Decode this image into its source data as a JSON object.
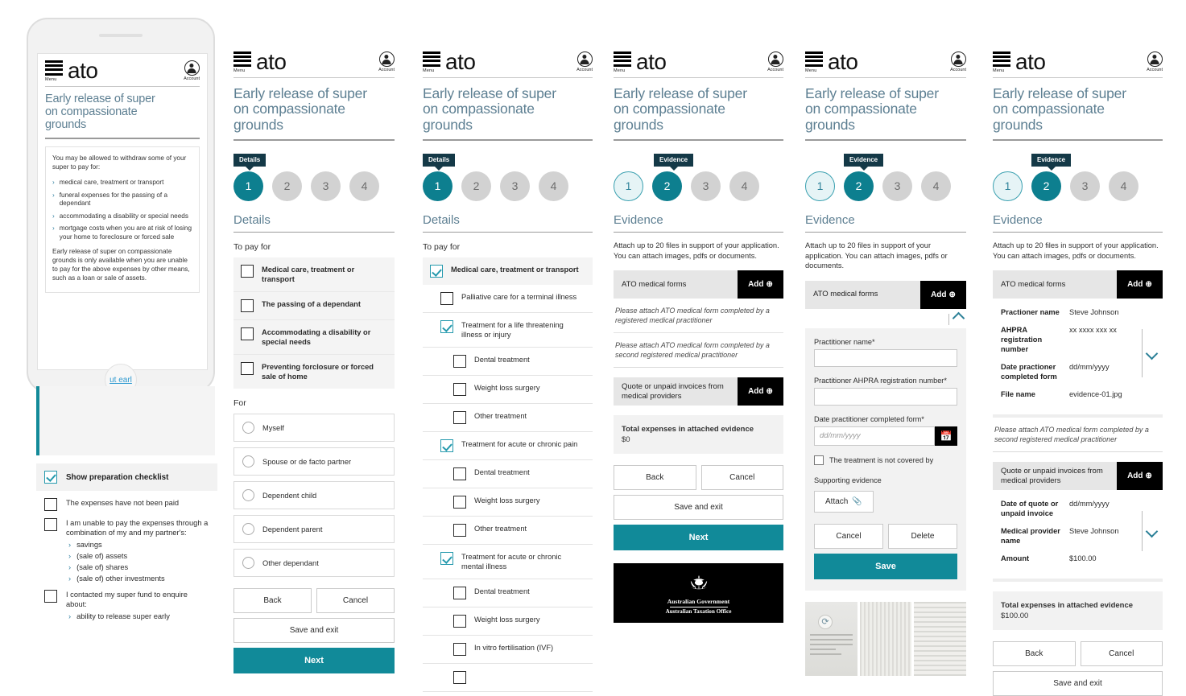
{
  "brand": {
    "logo_text": "ato",
    "menu_label": "Menu",
    "account_label": "Account"
  },
  "page_title": "Early release of super\non compassionate\ngrounds",
  "screen1": {
    "intro": "You may be allowed to withdraw some of your super to pay for:",
    "bullets": [
      "medical care, treatment or transport",
      "funeral expenses for the passing of a dependant",
      "accommodating a disability or special needs",
      "mortgage costs when you are at risk of losing your home to foreclosure or forced sale"
    ],
    "paragraph": "Early release of super on compassionate grounds is only available when you are unable to pay for the above expenses by other means, such as a loan or sale of assets.",
    "home_link": "ut earl",
    "checklist_header": "Show preparation checklist",
    "checklist": [
      {
        "label": "The expenses have not been paid",
        "subs": []
      },
      {
        "label": "I am unable to pay the expenses through a combination of my and my partner's:",
        "subs": [
          "savings",
          "(sale of) assets",
          "(sale of) shares",
          "(sale of) other investments"
        ]
      },
      {
        "label": "I contacted my super fund to enquire about:",
        "subs": [
          "ability to release super early"
        ]
      }
    ]
  },
  "screen2": {
    "tooltip": "Details",
    "steps": [
      "1",
      "2",
      "3",
      "4"
    ],
    "section_title": "Details",
    "topay_label": "To pay for",
    "topay": [
      "Medical care, treatment or transport",
      "The passing of a dependant",
      "Accommodating a disability or special needs",
      "Preventing forclosure or forced sale of home"
    ],
    "for_label": "For",
    "for_options": [
      "Myself",
      "Spouse or de facto partner",
      "Dependent child",
      "Dependent parent",
      "Other dependant"
    ],
    "back": "Back",
    "cancel": "Cancel",
    "save_exit": "Save and exit",
    "next": "Next"
  },
  "screen3": {
    "tooltip": "Details",
    "steps": [
      "1",
      "2",
      "3",
      "4"
    ],
    "section_title": "Details",
    "topay_label": "To pay for",
    "tree": [
      {
        "level": 0,
        "label": "Medical care, treatment or transport",
        "checked": true,
        "bold": true,
        "shade": true
      },
      {
        "level": 1,
        "label": "Palliative care for a terminal illness",
        "checked": false
      },
      {
        "level": 1,
        "label": "Treatment for a life threatening illness or injury",
        "checked": true
      },
      {
        "level": 2,
        "label": "Dental treatment",
        "checked": false
      },
      {
        "level": 2,
        "label": "Weight loss surgery",
        "checked": false
      },
      {
        "level": 2,
        "label": "Other treatment",
        "checked": false
      },
      {
        "level": 1,
        "label": "Treatment for acute or chronic pain",
        "checked": true
      },
      {
        "level": 2,
        "label": "Dental treatment",
        "checked": false
      },
      {
        "level": 2,
        "label": "Weight loss surgery",
        "checked": false
      },
      {
        "level": 2,
        "label": "Other treatment",
        "checked": false
      },
      {
        "level": 1,
        "label": "Treatment for acute or chronic mental illness",
        "checked": true
      },
      {
        "level": 2,
        "label": "Dental treatment",
        "checked": false
      },
      {
        "level": 2,
        "label": "Weight loss surgery",
        "checked": false
      },
      {
        "level": 2,
        "label": "In vitro fertilisation (IVF)",
        "checked": false
      },
      {
        "level": 2,
        "label": "",
        "checked": false
      }
    ]
  },
  "screen4": {
    "tooltip": "Evidence",
    "steps": [
      "1",
      "2",
      "3",
      "4"
    ],
    "section_title": "Evidence",
    "lead": "Attach up to 20 files in support of your application. You can attach images, pdfs or documents.",
    "acc1_title": "ATO medical forms",
    "add_label": "Add",
    "hint1": "Please attach ATO medical form completed by a registered medical practitioner",
    "hint2": "Please attach ATO medical form completed by a second registered medical practitioner",
    "acc2_title": "Quote or unpaid invoices from medical providers",
    "total_label": "Total expenses in attached evidence",
    "total_value": "$0",
    "back": "Back",
    "cancel": "Cancel",
    "save_exit": "Save and exit",
    "next": "Next",
    "crest_line1": "Australian Government",
    "crest_line2": "Australian Taxation Office"
  },
  "screen5": {
    "tooltip": "Evidence",
    "steps": [
      "1",
      "2",
      "3",
      "4"
    ],
    "section_title": "Evidence",
    "lead": "Attach up to 20 files in support of your application. You can attach images, pdfs or documents.",
    "acc1_title": "ATO medical forms",
    "add_label": "Add",
    "f_name_label": "Practitioner name*",
    "f_name_value": "",
    "f_ahpra_label": "Practitioner AHPRA registration number*",
    "f_ahpra_value": "",
    "f_date_label": "Date practitioner completed form*",
    "f_date_placeholder": "dd/mm/yyyy",
    "not_covered": "The treatment is not covered by",
    "supporting_label": "Supporting evidence",
    "attach": "Attach",
    "cancel": "Cancel",
    "delete": "Delete",
    "save": "Save"
  },
  "screen6": {
    "tooltip": "Evidence",
    "steps": [
      "1",
      "2",
      "3",
      "4"
    ],
    "section_title": "Evidence",
    "lead": "Attach up to 20 files in support of your application. You can attach images, pdfs or documents.",
    "acc1_title": "ATO medical forms",
    "add_label": "Add",
    "record1": [
      {
        "term": "Practioner name",
        "value": "Steve Johnson"
      },
      {
        "term": "AHPRA registration number",
        "value": "xx xxxx xxx xx"
      },
      {
        "term": "Date practioner completed form",
        "value": "dd/mm/yyyy"
      },
      {
        "term": "File name",
        "value": "evidence-01.jpg"
      }
    ],
    "hint2": "Please attach ATO medical form completed by a second registered medical practitioner",
    "acc2_title": "Quote or unpaid invoices from medical providers",
    "record2": [
      {
        "term": "Date of quote or unpaid invoice",
        "value": "dd/mm/yyyy"
      },
      {
        "term": "Medical provider name",
        "value": "Steve Johnson"
      },
      {
        "term": "Amount",
        "value": "$100.00"
      }
    ],
    "total_label": "Total expenses in attached evidence",
    "total_value": "$100.00",
    "back": "Back",
    "cancel": "Cancel",
    "save_exit": "Save and exit"
  },
  "colors": {
    "teal": "#118a99",
    "teal_dark": "#0d7f8f",
    "navy": "#143947",
    "title_blue": "#5d7f92"
  }
}
